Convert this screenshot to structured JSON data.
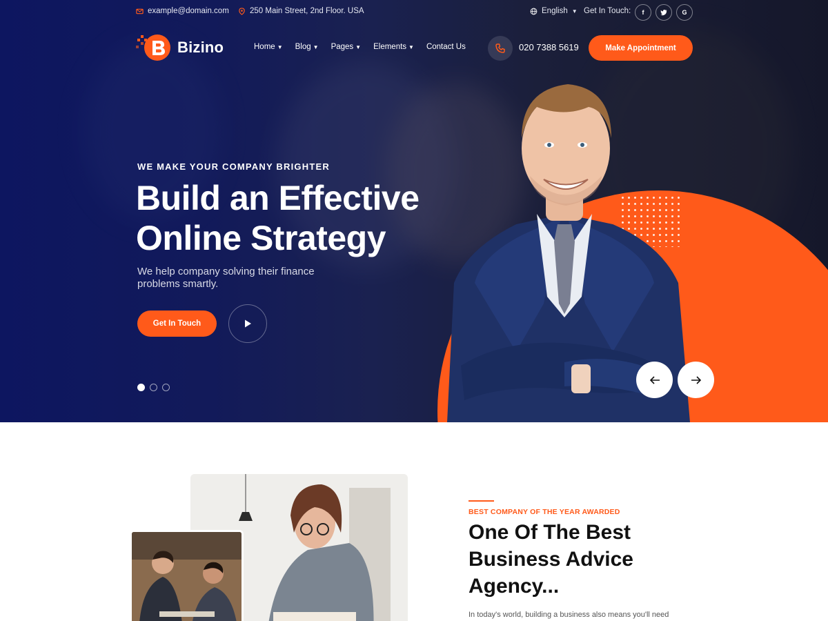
{
  "topbar": {
    "email": "example@domain.com",
    "address": "250 Main Street, 2nd Floor. USA",
    "language": "English",
    "get_in_touch": "Get In Touch:",
    "social": [
      "f",
      "t",
      "G"
    ]
  },
  "brand": {
    "name": "Bizino",
    "accent": "#ff5a1a",
    "navy": "#0d1660"
  },
  "nav": {
    "items": [
      {
        "label": "Home",
        "dropdown": true
      },
      {
        "label": "Blog",
        "dropdown": true
      },
      {
        "label": "Pages",
        "dropdown": true
      },
      {
        "label": "Elements",
        "dropdown": true
      },
      {
        "label": "Contact Us",
        "dropdown": false
      }
    ],
    "phone": "020 7388 5619",
    "cta": "Make Appointment"
  },
  "hero": {
    "eyebrow": "WE MAKE YOUR COMPANY BRIGHTER",
    "headline_line1": "Build an Effective",
    "headline_line2": "Online Strategy",
    "subtext": "We help company solving their finance problems smartly.",
    "button": "Get In Touch",
    "slides_total": 3,
    "slide_active": 1
  },
  "about": {
    "eyebrow": "BEST COMPANY OF THE YEAR AWARDED",
    "title": "One Of The Best Business Advice Agency...",
    "text": "In today's world, building a business also means you'll need"
  }
}
